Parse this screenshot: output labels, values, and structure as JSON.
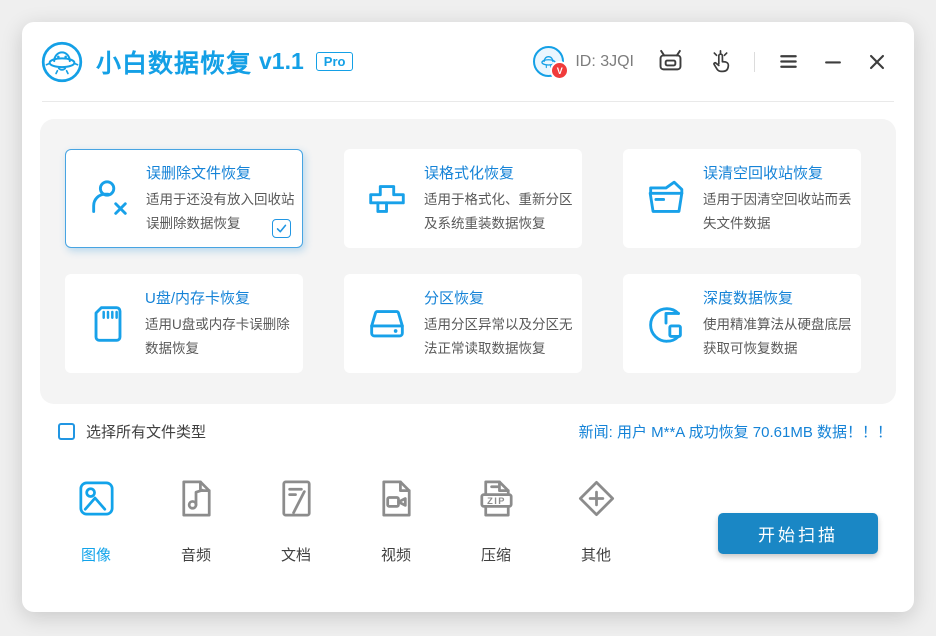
{
  "titlebar": {
    "app_title": "小白数据恢复",
    "version": "v1.1",
    "badge": "Pro",
    "user_id": "ID: 3JQI",
    "avatar_badge": "V"
  },
  "recovery_modes": [
    {
      "title": "误删除文件恢复",
      "desc": "适用于还没有放入回收站误删除数据恢复",
      "icon": "user-delete-icon",
      "selected": true
    },
    {
      "title": "误格式化恢复",
      "desc": "适用于格式化、重新分区及系统重装数据恢复",
      "icon": "format-brush-icon",
      "selected": false
    },
    {
      "title": "误清空回收站恢复",
      "desc": "适用于因清空回收站而丢失文件数据",
      "icon": "recycle-bin-icon",
      "selected": false
    },
    {
      "title": "U盘/内存卡恢复",
      "desc": "适用U盘或内存卡误删除数据恢复",
      "icon": "sd-card-icon",
      "selected": false
    },
    {
      "title": "分区恢复",
      "desc": "适用分区异常以及分区无法正常读取数据恢复",
      "icon": "hard-drive-icon",
      "selected": false
    },
    {
      "title": "深度数据恢复",
      "desc": "使用精准算法从硬盘底层获取可恢复数据",
      "icon": "deep-scan-icon",
      "selected": false
    }
  ],
  "select_all_label": "选择所有文件类型",
  "news_text": "新闻: 用户 M**A 成功恢复 70.61MB 数据！！！",
  "file_types": [
    {
      "label": "图像",
      "icon": "image-file-icon",
      "selected": true
    },
    {
      "label": "音频",
      "icon": "audio-file-icon",
      "selected": false
    },
    {
      "label": "文档",
      "icon": "document-file-icon",
      "selected": false
    },
    {
      "label": "视频",
      "icon": "video-file-icon",
      "selected": false
    },
    {
      "label": "压缩",
      "icon": "zip-file-icon",
      "icon_text": "ZIP",
      "selected": false
    },
    {
      "label": "其他",
      "icon": "other-file-icon",
      "selected": false
    }
  ],
  "scan_button_label": "开始扫描",
  "colors": {
    "brand_blue": "#14a0e6",
    "link_blue": "#1583d7",
    "button_blue": "#1a87c5",
    "selected_border": "#47a4e2",
    "badge_red": "#f03b3b"
  }
}
